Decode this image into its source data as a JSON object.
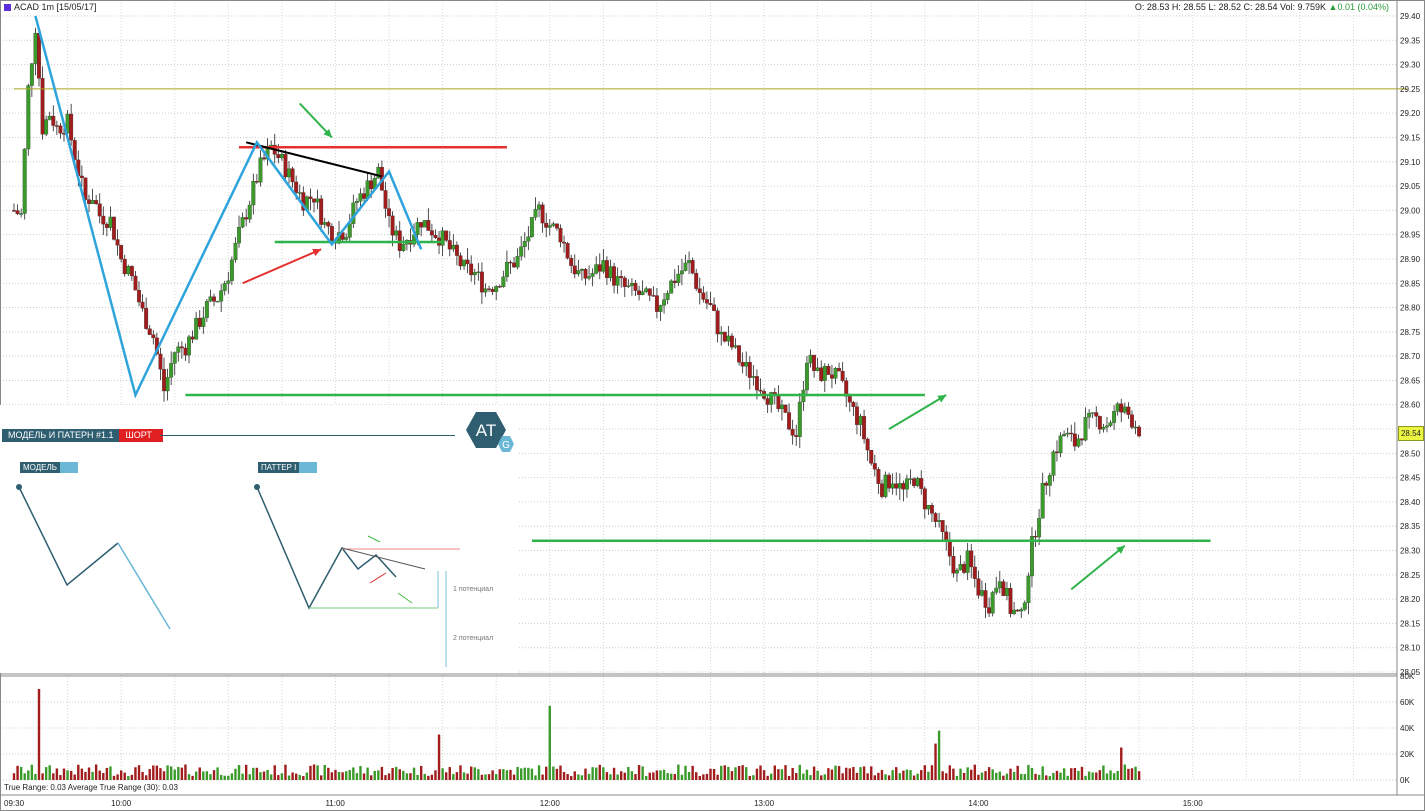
{
  "header": {
    "symbol": "ACAD 1m [15/05/17]",
    "ohlc": "O: 28.53 H: 28.55 L: 28.52 C: 28.54 Vol: 9.759K",
    "change": "▲0.01 (0.04%)"
  },
  "footer": {
    "indicator": "True Range: 0.03 Average True Range (30): 0.03"
  },
  "last_price_label": "28.54",
  "overlay": {
    "title": "МОДЕЛЬ И ПАТЕРН #1.1",
    "signal": "ШОРТ",
    "model_tag": "МОДЕЛЬ",
    "pattern_tag": "ПАТТЕР I",
    "logo": "AT",
    "logo_sub": "G",
    "pot1": "1 потенциал",
    "pot2": "2 потенциал"
  },
  "colors": {
    "up": "#3a9a2a",
    "down": "#a11c1c",
    "pattern": "#2fa4dc",
    "support": "#2fb34a",
    "resistance": "#e63030",
    "trend": "#000000",
    "level": "#a8a820",
    "overlay_dark": "#2e5e70"
  },
  "chart_data": {
    "type": "candlestick",
    "symbol": "ACAD",
    "interval": "1m",
    "date": "15/05/17",
    "ylim": [
      28.05,
      29.4
    ],
    "y_ticks": [
      "29.40",
      "29.35",
      "29.30",
      "29.25",
      "29.20",
      "29.15",
      "29.10",
      "29.05",
      "29.00",
      "28.95",
      "28.90",
      "28.85",
      "28.80",
      "28.75",
      "28.70",
      "28.65",
      "28.60",
      "28.55",
      "28.50",
      "28.45",
      "28.40",
      "28.35",
      "28.30",
      "28.25",
      "28.20",
      "28.15",
      "28.10",
      "28.05"
    ],
    "x_ticks": [
      "09:30",
      "10:00",
      "11:00",
      "12:00",
      "13:00",
      "14:00",
      "15:00"
    ],
    "x_tick_times": [
      570,
      600,
      660,
      720,
      780,
      840,
      900
    ],
    "session": [
      570,
      960
    ],
    "close_path": [
      [
        570,
        29.0
      ],
      [
        572,
        28.99
      ],
      [
        574,
        29.25
      ],
      [
        576,
        29.38
      ],
      [
        578,
        29.17
      ],
      [
        580,
        29.2
      ],
      [
        582,
        29.17
      ],
      [
        585,
        29.18
      ],
      [
        588,
        29.08
      ],
      [
        590,
        29.02
      ],
      [
        592,
        29.03
      ],
      [
        594,
        28.99
      ],
      [
        597,
        28.98
      ],
      [
        600,
        28.9
      ],
      [
        603,
        28.86
      ],
      [
        606,
        28.79
      ],
      [
        609,
        28.74
      ],
      [
        612,
        28.63
      ],
      [
        615,
        28.71
      ],
      [
        618,
        28.72
      ],
      [
        621,
        28.76
      ],
      [
        624,
        28.8
      ],
      [
        627,
        28.82
      ],
      [
        630,
        28.87
      ],
      [
        633,
        28.95
      ],
      [
        636,
        29.02
      ],
      [
        639,
        29.09
      ],
      [
        642,
        29.13
      ],
      [
        645,
        29.1
      ],
      [
        648,
        29.06
      ],
      [
        651,
        29.02
      ],
      [
        654,
        29.03
      ],
      [
        657,
        28.97
      ],
      [
        660,
        28.95
      ],
      [
        663,
        28.96
      ],
      [
        666,
        29.02
      ],
      [
        669,
        29.05
      ],
      [
        672,
        29.08
      ],
      [
        675,
        28.97
      ],
      [
        678,
        28.93
      ],
      [
        681,
        28.95
      ],
      [
        684,
        28.98
      ],
      [
        687,
        28.96
      ],
      [
        690,
        28.94
      ],
      [
        693,
        28.91
      ],
      [
        696,
        28.88
      ],
      [
        699,
        28.87
      ],
      [
        702,
        28.84
      ],
      [
        705,
        28.85
      ],
      [
        708,
        28.88
      ],
      [
        711,
        28.9
      ],
      [
        714,
        28.95
      ],
      [
        717,
        29.0
      ],
      [
        720,
        28.97
      ],
      [
        723,
        28.95
      ],
      [
        726,
        28.89
      ],
      [
        729,
        28.86
      ],
      [
        732,
        28.87
      ],
      [
        735,
        28.89
      ],
      [
        738,
        28.86
      ],
      [
        741,
        28.84
      ],
      [
        744,
        28.83
      ],
      [
        747,
        28.82
      ],
      [
        750,
        28.8
      ],
      [
        753,
        28.84
      ],
      [
        756,
        28.87
      ],
      [
        759,
        28.89
      ],
      [
        762,
        28.83
      ],
      [
        765,
        28.8
      ],
      [
        768,
        28.74
      ],
      [
        771,
        28.72
      ],
      [
        774,
        28.68
      ],
      [
        777,
        28.66
      ],
      [
        780,
        28.63
      ],
      [
        783,
        28.6
      ],
      [
        786,
        28.57
      ],
      [
        789,
        28.54
      ],
      [
        792,
        28.7
      ],
      [
        795,
        28.66
      ],
      [
        798,
        28.67
      ],
      [
        801,
        28.65
      ],
      [
        804,
        28.6
      ],
      [
        807,
        28.56
      ],
      [
        810,
        28.48
      ],
      [
        813,
        28.43
      ],
      [
        816,
        28.45
      ],
      [
        819,
        28.42
      ],
      [
        822,
        28.45
      ],
      [
        825,
        28.4
      ],
      [
        828,
        28.36
      ],
      [
        831,
        28.31
      ],
      [
        834,
        28.25
      ],
      [
        837,
        28.28
      ],
      [
        840,
        28.22
      ],
      [
        843,
        28.19
      ],
      [
        846,
        28.25
      ],
      [
        849,
        28.18
      ],
      [
        852,
        28.16
      ],
      [
        855,
        28.31
      ],
      [
        858,
        28.42
      ],
      [
        861,
        28.5
      ],
      [
        864,
        28.54
      ],
      [
        867,
        28.52
      ],
      [
        870,
        28.56
      ],
      [
        873,
        28.57
      ],
      [
        876,
        28.56
      ],
      [
        879,
        28.59
      ],
      [
        882,
        28.58
      ],
      [
        885,
        28.55
      ]
    ],
    "volume_ylim": [
      0,
      80000
    ],
    "volume_ticks": [
      "80K",
      "60K",
      "40K",
      "20K",
      "0K"
    ],
    "volume_spikes": [
      {
        "time": 577,
        "volume": 70000
      },
      {
        "time": 689,
        "volume": 35000
      },
      {
        "time": 720,
        "volume": 57000
      },
      {
        "time": 829,
        "volume": 38000
      },
      {
        "time": 828,
        "volume": 28000
      },
      {
        "time": 880,
        "volume": 25000
      }
    ],
    "annotations": {
      "horizontal_levels": [
        {
          "price": 29.25,
          "color_key": "level",
          "from": 570,
          "to": 960
        },
        {
          "price": 28.62,
          "color_key": "support",
          "from": 618,
          "to": 825
        },
        {
          "price": 28.32,
          "color_key": "support",
          "from": 715,
          "to": 905
        },
        {
          "price": 28.935,
          "color_key": "support",
          "from": 643,
          "to": 690
        },
        {
          "price": 29.13,
          "color_key": "resistance",
          "from": 633,
          "to": 708
        }
      ],
      "trendline": {
        "from": [
          635,
          29.14
        ],
        "to": [
          673,
          29.07
        ]
      },
      "zigzag": [
        [
          576,
          29.4
        ],
        [
          604,
          28.62
        ],
        [
          638,
          29.14
        ],
        [
          659,
          28.93
        ],
        [
          675,
          29.08
        ],
        [
          684,
          28.92
        ]
      ],
      "arrows_green": [
        {
          "from": [
            650,
            29.22
          ],
          "to": [
            659,
            29.15
          ]
        },
        {
          "from": [
            815,
            28.55
          ],
          "to": [
            831,
            28.62
          ]
        },
        {
          "from": [
            866,
            28.22
          ],
          "to": [
            881,
            28.31
          ]
        }
      ],
      "arrows_red": [
        {
          "from": [
            634,
            28.85
          ],
          "to": [
            656,
            28.92
          ]
        }
      ]
    }
  }
}
